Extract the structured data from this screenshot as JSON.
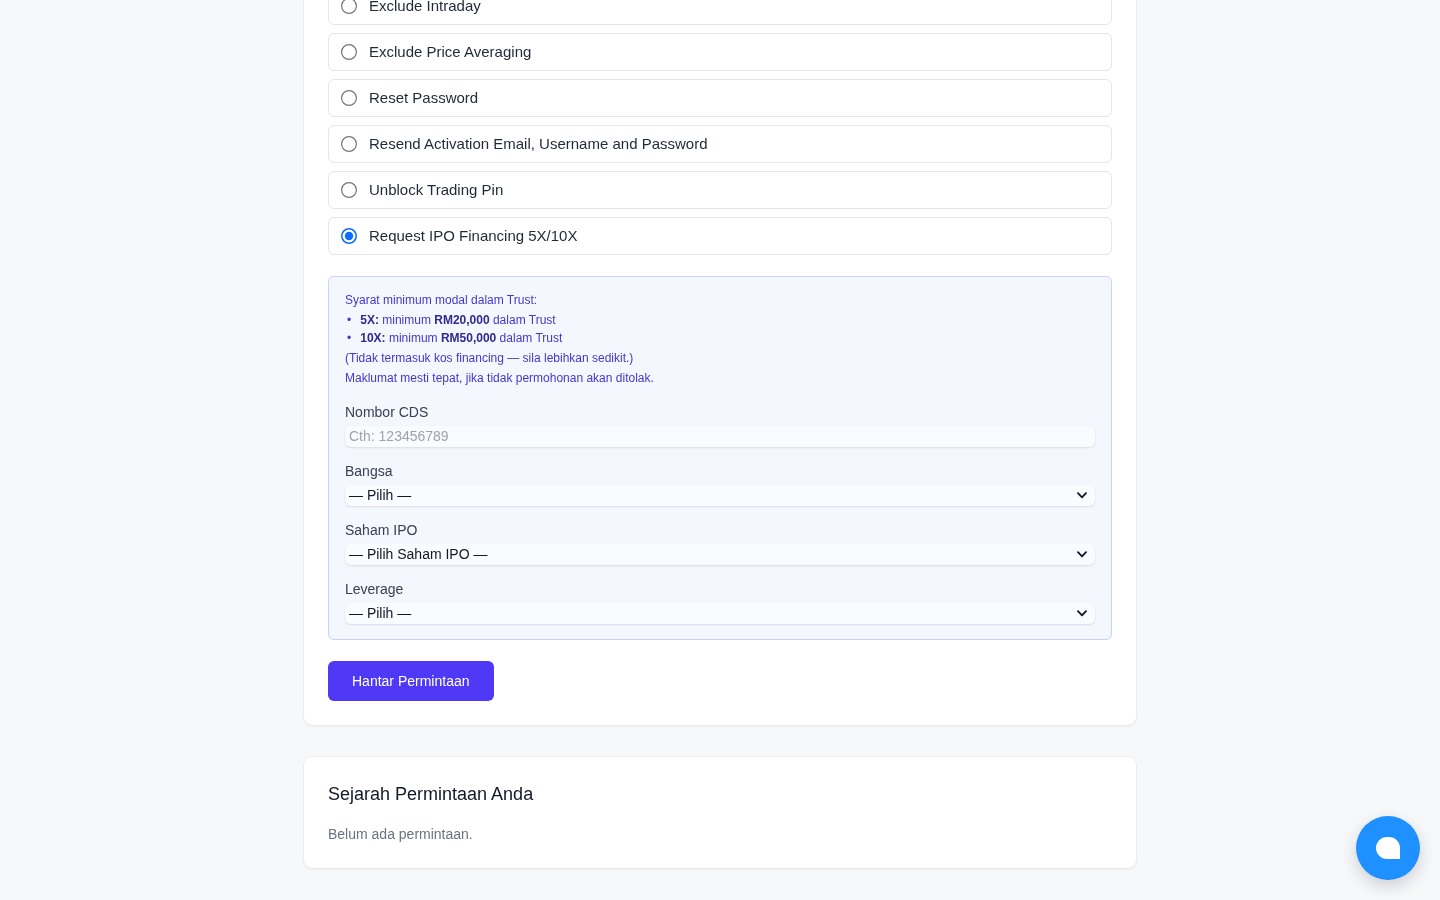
{
  "request_types": {
    "options": [
      {
        "label": "Exclude Intraday",
        "selected": false
      },
      {
        "label": "Exclude Price Averaging",
        "selected": false
      },
      {
        "label": "Reset Password",
        "selected": false
      },
      {
        "label": "Resend Activation Email, Username and Password",
        "selected": false
      },
      {
        "label": "Unblock Trading Pin",
        "selected": false
      },
      {
        "label": "Request IPO Financing 5X/10X",
        "selected": true
      }
    ]
  },
  "ipo_panel": {
    "notice": {
      "heading": "Syarat minimum modal dalam Trust:",
      "bullets": [
        {
          "marker": "•",
          "text": "**5X:** minimum **RM20,000** dalam Trust"
        },
        {
          "marker": "•",
          "text": "**10X:** minimum **RM50,000** dalam Trust"
        }
      ],
      "notes": [
        "(Tidak termasuk kos financing — sila lebihkan sedikit.)",
        "Maklumat mesti tepat, jika tidak permohonan akan ditolak."
      ]
    },
    "fields": [
      {
        "kind": "text",
        "label": "Nombor CDS",
        "placeholder": "Cth: 123456789"
      },
      {
        "kind": "select",
        "label": "Bangsa",
        "value": "— Pilih —"
      },
      {
        "kind": "select",
        "label": "Saham IPO",
        "value": "— Pilih Saham IPO —"
      },
      {
        "kind": "select",
        "label": "Leverage",
        "value": "— Pilih —"
      }
    ]
  },
  "submit_button": {
    "label": "Hantar Permintaan"
  },
  "history": {
    "title": "Sejarah Permintaan Anda",
    "empty_message": "Belum ada permintaan."
  }
}
